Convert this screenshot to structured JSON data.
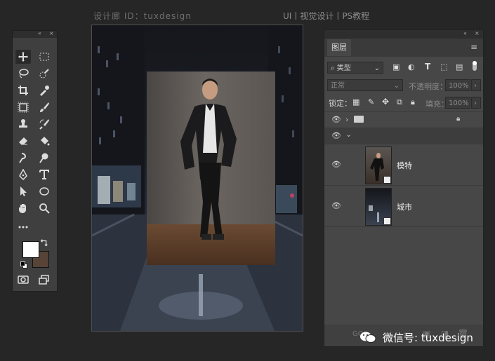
{
  "header": {
    "left_text": "设计廊 ID：tuxdesign",
    "right_text": "UI丨视觉设计丨PS教程"
  },
  "toolbox": {
    "collapse_icon": "«",
    "close_icon": "×",
    "tools": [
      "move",
      "marquee",
      "lasso",
      "quick-select",
      "crop",
      "eyedropper",
      "frame",
      "brush",
      "stamp",
      "history-brush",
      "eraser",
      "bucket",
      "dodge",
      "pen-tip",
      "pen",
      "type",
      "path-select",
      "ellipse",
      "hand",
      "zoom",
      "more"
    ],
    "fg_color": "#ffffff",
    "bg_color": "#574437"
  },
  "layers_panel": {
    "tab_label": "图层",
    "filter_label": "类型",
    "blend_mode": "正常",
    "opacity_label": "不透明度：",
    "opacity_value": "100%",
    "lock_label": "锁定：",
    "fill_label": "填充：",
    "fill_value": "100%",
    "layers": [
      {
        "name": "",
        "type": "group",
        "expanded": false
      },
      {
        "name": "",
        "type": "group",
        "expanded": true
      },
      {
        "name": "模特",
        "type": "smart-object"
      },
      {
        "name": "城市",
        "type": "smart-object"
      }
    ]
  },
  "watermark": {
    "text": "微信号: tuxdesign"
  }
}
